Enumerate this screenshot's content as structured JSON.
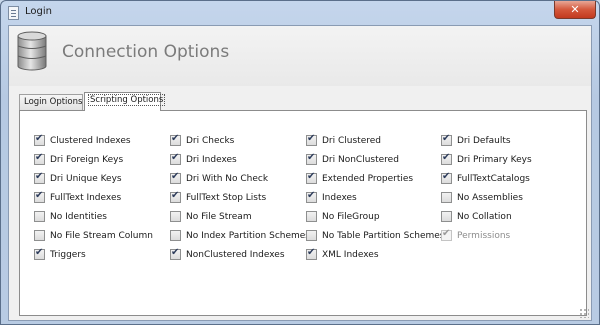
{
  "window": {
    "title": "Login",
    "close_glyph": "✕"
  },
  "header": {
    "title": "Connection Options",
    "icon": "database-icon"
  },
  "tabs": [
    {
      "label": "Login Options",
      "active": false
    },
    {
      "label": "Scripting Options",
      "active": true
    }
  ],
  "options": [
    {
      "label": "Clustered Indexes",
      "checked": true,
      "enabled": true
    },
    {
      "label": "Dri Foreign Keys",
      "checked": true,
      "enabled": true
    },
    {
      "label": "Dri Unique Keys",
      "checked": true,
      "enabled": true
    },
    {
      "label": "FullText Indexes",
      "checked": true,
      "enabled": true
    },
    {
      "label": "No Identities",
      "checked": false,
      "enabled": true
    },
    {
      "label": "No File Stream Column",
      "checked": false,
      "enabled": true
    },
    {
      "label": "Triggers",
      "checked": true,
      "enabled": true
    },
    {
      "label": "Dri Checks",
      "checked": true,
      "enabled": true
    },
    {
      "label": "Dri Indexes",
      "checked": true,
      "enabled": true
    },
    {
      "label": "Dri With No Check",
      "checked": true,
      "enabled": true
    },
    {
      "label": "FullText Stop Lists",
      "checked": true,
      "enabled": true
    },
    {
      "label": "No File Stream",
      "checked": false,
      "enabled": true
    },
    {
      "label": "No Index Partition Schemes",
      "checked": false,
      "enabled": true
    },
    {
      "label": "NonClustered Indexes",
      "checked": true,
      "enabled": true
    },
    {
      "label": "Dri Clustered",
      "checked": true,
      "enabled": true
    },
    {
      "label": "Dri NonClustered",
      "checked": true,
      "enabled": true
    },
    {
      "label": "Extended Properties",
      "checked": true,
      "enabled": true
    },
    {
      "label": "Indexes",
      "checked": true,
      "enabled": true
    },
    {
      "label": "No FileGroup",
      "checked": false,
      "enabled": true
    },
    {
      "label": "No Table Partition Schemes",
      "checked": false,
      "enabled": true
    },
    {
      "label": "XML Indexes",
      "checked": true,
      "enabled": true
    },
    {
      "label": "Dri Defaults",
      "checked": true,
      "enabled": true
    },
    {
      "label": "Dri Primary Keys",
      "checked": true,
      "enabled": true
    },
    {
      "label": "FullTextCatalogs",
      "checked": true,
      "enabled": true
    },
    {
      "label": "No Assemblies",
      "checked": false,
      "enabled": true
    },
    {
      "label": "No Collation",
      "checked": false,
      "enabled": true
    },
    {
      "label": "Permissions",
      "checked": true,
      "enabled": false
    }
  ]
}
